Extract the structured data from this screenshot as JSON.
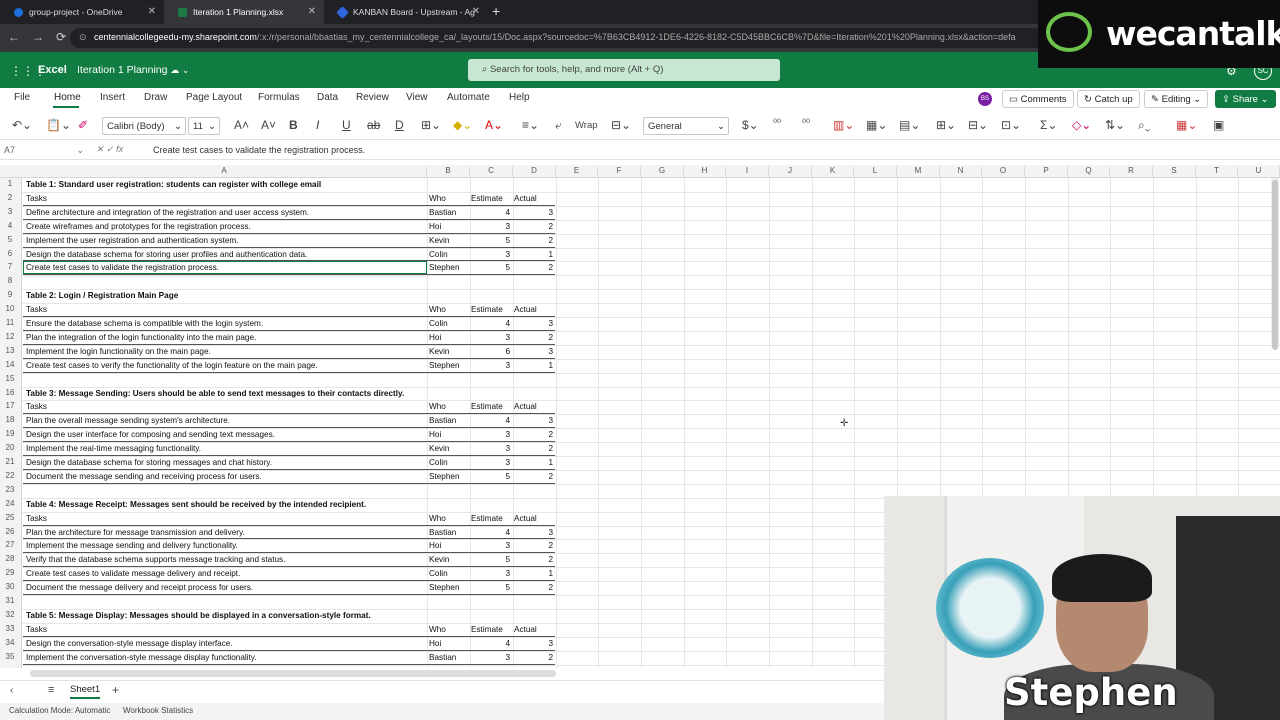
{
  "browser": {
    "tabs": [
      {
        "label": "group-project - OneDrive",
        "color": "#1e6fd9"
      },
      {
        "label": "Iteration 1 Planning.xlsx",
        "color": "#1d7a45"
      },
      {
        "label": "KANBAN Board - Upstream - Ag",
        "color": "#2f66e0"
      }
    ],
    "url_host": "centennialcollegeedu-my.sharepoint.com",
    "url_path": "/:x:/r/personal/bbastias_my_centennialcollege_ca/_layouts/15/Doc.aspx?sourcedoc=%7B63CB4912-1DE6-4226-8182-C5D45BBC6CB%7D&file=Iteration%201%20Planning.xlsx&action=defa"
  },
  "logo": {
    "text": "wecantalk"
  },
  "excel": {
    "app_name": "Excel",
    "doc_name": "Iteration 1 Planning",
    "search_placeholder": "Search for tools, help, and more (Alt + Q)",
    "avatar": "SC",
    "menu": [
      "File",
      "Home",
      "Insert",
      "Draw",
      "Page Layout",
      "Formulas",
      "Data",
      "Review",
      "View",
      "Automate",
      "Help"
    ],
    "user_badge": "BS",
    "comments_label": "Comments",
    "catchup_label": "Catch up",
    "editing_label": "Editing",
    "share_label": "Share",
    "font_name": "Calibri (Body)",
    "font_size": "11",
    "wrap_label": "Wrap",
    "number_format": "General",
    "name_box": "A7",
    "formula": "Create test cases to validate the registration process.",
    "columns": [
      "A",
      "B",
      "C",
      "D",
      "E",
      "F",
      "G",
      "H",
      "I",
      "J",
      "K",
      "L",
      "M",
      "N",
      "O",
      "P",
      "Q",
      "R",
      "S",
      "T",
      "U"
    ],
    "sheet_name": "Sheet1",
    "status": [
      "Calculation Mode: Automatic",
      "Workbook Statistics"
    ]
  },
  "sheet_rows": [
    {
      "r": "1",
      "a": "Table 1: Standard user registration: students can register with college email",
      "bold": true
    },
    {
      "r": "2",
      "a": "Tasks",
      "b": "Who",
      "c": "Estimate",
      "d": "Actual",
      "hdr": true
    },
    {
      "r": "3",
      "a": "Define architecture and integration of the registration and user access system.",
      "b": "Bastian",
      "c": "4",
      "d": "3"
    },
    {
      "r": "4",
      "a": "Create wireframes and prototypes for the registration process.",
      "b": "Hoi",
      "c": "3",
      "d": "2"
    },
    {
      "r": "5",
      "a": "Implement the user registration and authentication system.",
      "b": "Kevin",
      "c": "5",
      "d": "2"
    },
    {
      "r": "6",
      "a": "Design the database schema for storing user profiles and authentication data.",
      "b": "Colin",
      "c": "3",
      "d": "1"
    },
    {
      "r": "7",
      "a": "Create test cases to validate the registration process.",
      "b": "Stephen",
      "c": "5",
      "d": "2"
    },
    {
      "r": "8"
    },
    {
      "r": "9",
      "a": "Table 2: Login / Registration Main Page",
      "bold": true
    },
    {
      "r": "10",
      "a": "Tasks",
      "b": "Who",
      "c": "Estimate",
      "d": "Actual",
      "hdr": true
    },
    {
      "r": "11",
      "a": "Ensure the database schema is compatible with the login system.",
      "b": "Colin",
      "c": "4",
      "d": "3"
    },
    {
      "r": "12",
      "a": "Plan the integration of the login functionality into the main page.",
      "b": "Hoi",
      "c": "3",
      "d": "2"
    },
    {
      "r": "13",
      "a": "Implement the login functionality on the main page.",
      "b": "Kevin",
      "c": "6",
      "d": "3"
    },
    {
      "r": "14",
      "a": "Create test cases to verify the functionality of the login feature on the main page.",
      "b": "Stephen",
      "c": "3",
      "d": "1"
    },
    {
      "r": "15"
    },
    {
      "r": "16",
      "a": "Table 3: Message Sending: Users should be able to send text messages to their contacts directly.",
      "bold": true
    },
    {
      "r": "17",
      "a": "Tasks",
      "b": "Who",
      "c": "Estimate",
      "d": "Actual",
      "hdr": true
    },
    {
      "r": "18",
      "a": "Plan the overall message sending system's architecture.",
      "b": "Bastian",
      "c": "4",
      "d": "3"
    },
    {
      "r": "19",
      "a": "Design the user interface for composing and sending text messages.",
      "b": "Hoi",
      "c": "3",
      "d": "2"
    },
    {
      "r": "20",
      "a": "Implement the real-time messaging functionality.",
      "b": "Kevin",
      "c": "3",
      "d": "2"
    },
    {
      "r": "21",
      "a": "Design the database schema for storing messages and chat history.",
      "b": "Colin",
      "c": "3",
      "d": "1"
    },
    {
      "r": "22",
      "a": "Document the message sending and receiving process for users.",
      "b": "Stephen",
      "c": "5",
      "d": "2"
    },
    {
      "r": "23"
    },
    {
      "r": "24",
      "a": "Table 4: Message Receipt: Messages sent should be received by the intended recipient.",
      "bold": true
    },
    {
      "r": "25",
      "a": "Tasks",
      "b": "Who",
      "c": "Estimate",
      "d": "Actual",
      "hdr": true
    },
    {
      "r": "26",
      "a": "Plan the architecture for message transmission and delivery.",
      "b": "Bastian",
      "c": "4",
      "d": "3"
    },
    {
      "r": "27",
      "a": "Implement the message sending and delivery functionality.",
      "b": "Hoi",
      "c": "3",
      "d": "2"
    },
    {
      "r": "28",
      "a": "Verify that the database schema supports message tracking and status.",
      "b": "Kevin",
      "c": "5",
      "d": "2"
    },
    {
      "r": "29",
      "a": "Create test cases to validate message delivery and receipt.",
      "b": "Colin",
      "c": "3",
      "d": "1"
    },
    {
      "r": "30",
      "a": "Document the message delivery and receipt process for users.",
      "b": "Stephen",
      "c": "5",
      "d": "2"
    },
    {
      "r": "31"
    },
    {
      "r": "32",
      "a": "Table 5: Message Display: Messages should be displayed in a conversation-style format.",
      "bold": true
    },
    {
      "r": "33",
      "a": "Tasks",
      "b": "Who",
      "c": "Estimate",
      "d": "Actual",
      "hdr": true
    },
    {
      "r": "34",
      "a": "Design the conversation-style message display interface.",
      "b": "Hoi",
      "c": "4",
      "d": "3"
    },
    {
      "r": "35",
      "a": "Implement the conversation-style message display functionality.",
      "b": "Bastian",
      "c": "3",
      "d": "2"
    }
  ],
  "webcam": {
    "name": "Stephen"
  }
}
